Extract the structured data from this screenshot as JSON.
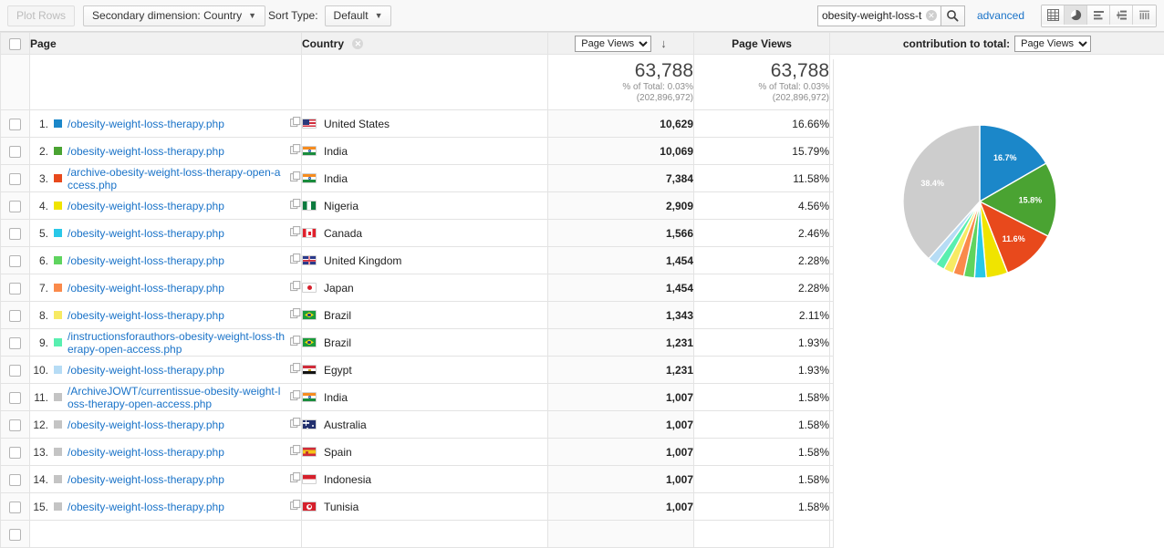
{
  "toolbar": {
    "plot_rows_label": "Plot Rows",
    "secondary_dimension_label": "Secondary dimension: Country",
    "sort_type_label": "Sort Type:",
    "sort_type_value": "Default",
    "search_value": "obesity-weight-loss-thera",
    "search_placeholder": "",
    "advanced_label": "advanced",
    "view_icons": [
      {
        "name": "table-view-icon",
        "active": false
      },
      {
        "name": "pie-chart-view-icon",
        "active": true
      },
      {
        "name": "bar-chart-view-icon",
        "active": false
      },
      {
        "name": "comparison-view-icon",
        "active": false
      },
      {
        "name": "pivot-view-icon",
        "active": false
      }
    ]
  },
  "table": {
    "headers": {
      "page": "Page",
      "country": "Country",
      "metric_select": "Page Views",
      "page_views": "Page Views",
      "contribution_label": "contribution to total:",
      "contribution_select": "Page Views"
    },
    "summary": {
      "page_views_total": "63,788",
      "page_views_percent": "% of Total: 0.03%",
      "page_views_base": "(202,896,972)",
      "contribution_total": "63,788",
      "contribution_percent": "% of Total: 0.03%",
      "contribution_base": "(202,896,972)"
    },
    "rows": [
      {
        "rank": "1.",
        "color": "#1b87c9",
        "page": "/obesity-weight-loss-therapy.php",
        "country": "United States",
        "flag": "us",
        "views": "10,629",
        "pct": "16.66%"
      },
      {
        "rank": "2.",
        "color": "#4aa332",
        "page": "/obesity-weight-loss-therapy.php",
        "country": "India",
        "flag": "in",
        "views": "10,069",
        "pct": "15.79%"
      },
      {
        "rank": "3.",
        "color": "#e8491c",
        "page": "/archive-obesity-weight-loss-therapy-open-access.php",
        "country": "India",
        "flag": "in",
        "views": "7,384",
        "pct": "11.58%"
      },
      {
        "rank": "4.",
        "color": "#f0e400",
        "page": "/obesity-weight-loss-therapy.php",
        "country": "Nigeria",
        "flag": "ng",
        "views": "2,909",
        "pct": "4.56%"
      },
      {
        "rank": "5.",
        "color": "#29c8e8",
        "page": "/obesity-weight-loss-therapy.php",
        "country": "Canada",
        "flag": "ca",
        "views": "1,566",
        "pct": "2.46%"
      },
      {
        "rank": "6.",
        "color": "#5fd45f",
        "page": "/obesity-weight-loss-therapy.php",
        "country": "United Kingdom",
        "flag": "gb",
        "views": "1,454",
        "pct": "2.28%"
      },
      {
        "rank": "7.",
        "color": "#fa8a4b",
        "page": "/obesity-weight-loss-therapy.php",
        "country": "Japan",
        "flag": "jp",
        "views": "1,454",
        "pct": "2.28%"
      },
      {
        "rank": "8.",
        "color": "#f7ea63",
        "page": "/obesity-weight-loss-therapy.php",
        "country": "Brazil",
        "flag": "br",
        "views": "1,343",
        "pct": "2.11%"
      },
      {
        "rank": "9.",
        "color": "#58efb0",
        "page": "/instructionsforauthors-obesity-weight-loss-therapy-open-access.php",
        "country": "Brazil",
        "flag": "br",
        "views": "1,231",
        "pct": "1.93%"
      },
      {
        "rank": "10.",
        "color": "#b6dcf5",
        "page": "/obesity-weight-loss-therapy.php",
        "country": "Egypt",
        "flag": "eg",
        "views": "1,231",
        "pct": "1.93%"
      },
      {
        "rank": "11.",
        "color": "#c4c4c4",
        "page": "/ArchiveJOWT/currentissue-obesity-weight-loss-therapy-open-access.php",
        "country": "India",
        "flag": "in",
        "views": "1,007",
        "pct": "1.58%"
      },
      {
        "rank": "12.",
        "color": "#c4c4c4",
        "page": "/obesity-weight-loss-therapy.php",
        "country": "Australia",
        "flag": "au",
        "views": "1,007",
        "pct": "1.58%"
      },
      {
        "rank": "13.",
        "color": "#c4c4c4",
        "page": "/obesity-weight-loss-therapy.php",
        "country": "Spain",
        "flag": "es",
        "views": "1,007",
        "pct": "1.58%"
      },
      {
        "rank": "14.",
        "color": "#c4c4c4",
        "page": "/obesity-weight-loss-therapy.php",
        "country": "Indonesia",
        "flag": "id",
        "views": "1,007",
        "pct": "1.58%"
      },
      {
        "rank": "15.",
        "color": "#c4c4c4",
        "page": "/obesity-weight-loss-therapy.php",
        "country": "Tunisia",
        "flag": "tn",
        "views": "1,007",
        "pct": "1.58%"
      }
    ]
  },
  "chart_data": {
    "type": "pie",
    "title": "",
    "metric": "Page Views",
    "legend": "none",
    "labels": [
      "16.7%",
      "15.8%",
      "11.6%",
      "38.4%"
    ],
    "slices": [
      {
        "label": "/obesity-weight-loss-therapy.php - United States",
        "value": 16.7,
        "color": "#1b87c9",
        "display_label": "16.7%"
      },
      {
        "label": "/obesity-weight-loss-therapy.php - India",
        "value": 15.8,
        "color": "#4aa332",
        "display_label": "15.8%"
      },
      {
        "label": "/archive-obesity-weight-loss-therapy-open-access.php - India",
        "value": 11.6,
        "color": "#e8491c",
        "display_label": "11.6%"
      },
      {
        "label": "/obesity-weight-loss-therapy.php - Nigeria",
        "value": 4.56,
        "color": "#f0e400",
        "display_label": ""
      },
      {
        "label": "/obesity-weight-loss-therapy.php - Canada",
        "value": 2.46,
        "color": "#29c8e8",
        "display_label": ""
      },
      {
        "label": "/obesity-weight-loss-therapy.php - United Kingdom",
        "value": 2.28,
        "color": "#5fd45f",
        "display_label": ""
      },
      {
        "label": "/obesity-weight-loss-therapy.php - Japan",
        "value": 2.28,
        "color": "#fa8a4b",
        "display_label": ""
      },
      {
        "label": "/obesity-weight-loss-therapy.php - Brazil",
        "value": 2.11,
        "color": "#f7ea63",
        "display_label": ""
      },
      {
        "label": "/instructionsforauthors-obesity-weight-loss-therapy-open-access.php - Brazil",
        "value": 1.93,
        "color": "#58efb0",
        "display_label": ""
      },
      {
        "label": "/obesity-weight-loss-therapy.php - Egypt",
        "value": 1.93,
        "color": "#b6dcf5",
        "display_label": ""
      },
      {
        "label": "Other",
        "value": 38.4,
        "color": "#cdcdcd",
        "display_label": "38.4%"
      }
    ]
  }
}
